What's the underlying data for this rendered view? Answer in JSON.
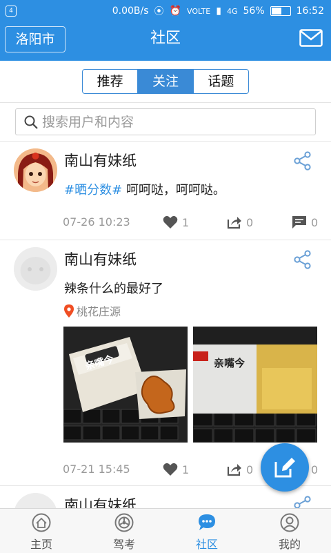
{
  "status_bar": {
    "speed": "0.00B/s",
    "network": "VOLTE",
    "signal": "4G",
    "battery": "56%",
    "time": "16:52"
  },
  "header": {
    "city": "洛阳市",
    "title": "社区",
    "mail_icon": "mail-icon"
  },
  "tabs": [
    {
      "label": "推荐"
    },
    {
      "label": "关注"
    },
    {
      "label": "话题"
    }
  ],
  "search": {
    "placeholder": "搜索用户和内容"
  },
  "posts": [
    {
      "user": "南山有妹纸",
      "hashtag": "#晒分数#",
      "text": " 呵呵哒，呵呵哒。",
      "time": "07-26 10:23",
      "likes": "1",
      "shares": "0",
      "comments": "0"
    },
    {
      "user": "南山有妹纸",
      "text": "辣条什么的最好了",
      "location": "桃花庄源",
      "time": "07-21 15:45",
      "likes": "1",
      "shares": "0",
      "comments": "0"
    },
    {
      "user": "南山有妹纸"
    }
  ],
  "photos": [
    {
      "label": "亲嘴今"
    },
    {
      "label": "亲嘴今"
    }
  ],
  "nav": [
    {
      "label": "主页"
    },
    {
      "label": "驾考"
    },
    {
      "label": "社区"
    },
    {
      "label": "我的"
    }
  ],
  "colors": {
    "primary": "#2d8fe2",
    "hashtag": "#2d8fe2",
    "location_pin": "#f04e23"
  }
}
